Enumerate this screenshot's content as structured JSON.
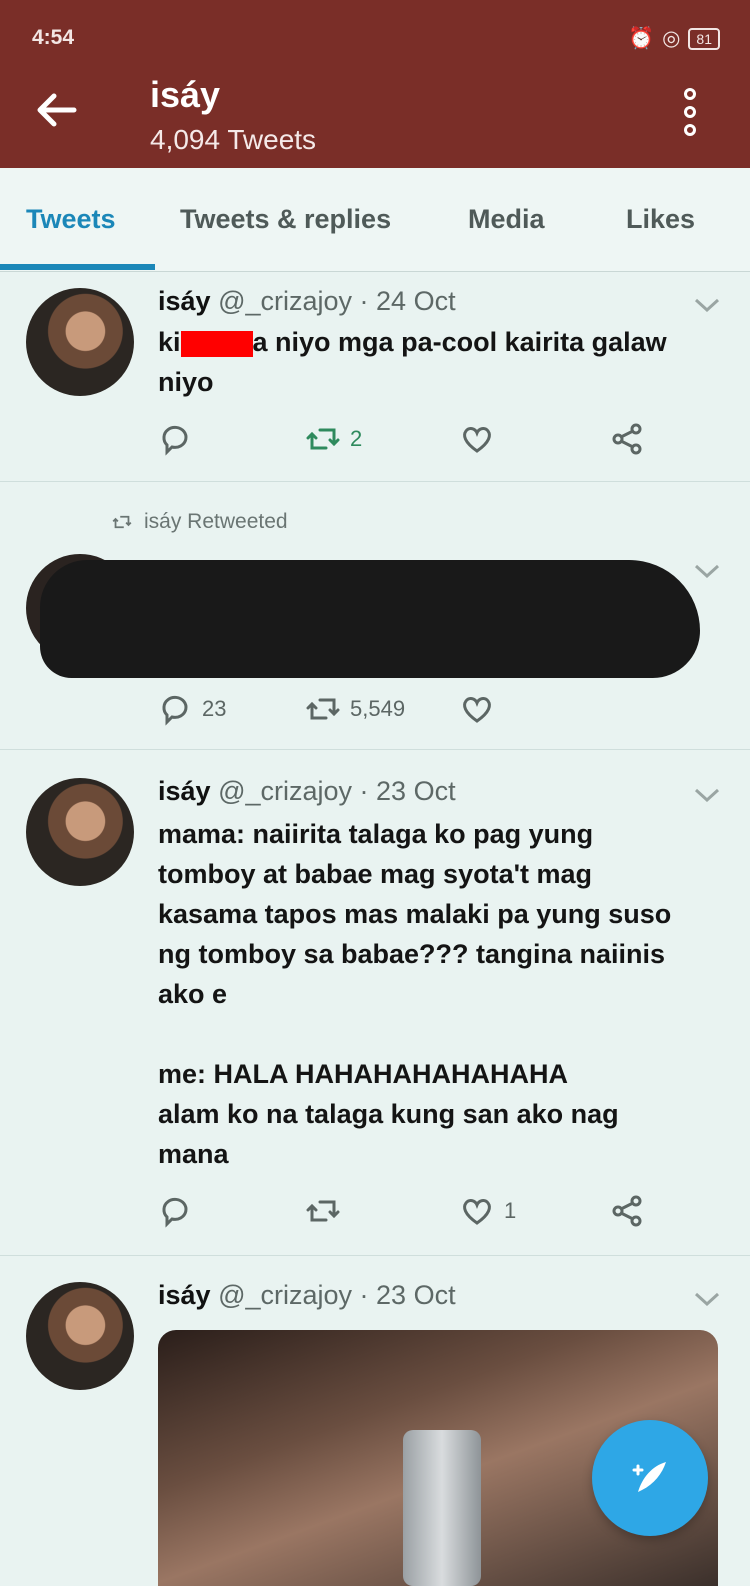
{
  "status": {
    "time": "4:54",
    "battery": "81"
  },
  "header": {
    "title": "isáy",
    "subtitle": "4,094 Tweets"
  },
  "tabs": [
    {
      "label": "Tweets",
      "active": true
    },
    {
      "label": "Tweets & replies",
      "active": false
    },
    {
      "label": "Media",
      "active": false
    },
    {
      "label": "Likes",
      "active": false
    }
  ],
  "tweets": [
    {
      "name": "isáy",
      "handle": "@_crizajoy",
      "date": "· 24 Oct",
      "text_lines": [
        "ki",
        "a niyo mga pa-cool kairita galaw",
        "niyo"
      ],
      "retweets": "2",
      "likes": ""
    },
    {
      "retweeted_note": "isáy Retweeted",
      "replies": "23",
      "retweets": "5,549"
    },
    {
      "name": "isáy",
      "handle": "@_crizajoy",
      "date": "· 23 Oct",
      "text_lines": [
        "mama: naiirita talaga ko pag yung",
        "tomboy at babae mag syota't mag",
        "kasama tapos mas malaki pa yung suso",
        "ng tomboy sa babae??? tangina naiinis",
        "ako e",
        "",
        "me: HALA HAHAHAHAHAHAHA",
        "alam ko na talaga kung san ako nag",
        "mana"
      ],
      "retweets": "",
      "likes": "1"
    },
    {
      "name": "isáy",
      "handle": "@_crizajoy",
      "date": "· 23 Oct"
    }
  ],
  "colors": {
    "header": "#7a2e28",
    "accent": "#1b87b8",
    "fab": "#2ea7e6",
    "retweet": "#2e8a5d"
  },
  "icons": [
    "back-arrow-icon",
    "more-vertical-icon",
    "reply-icon",
    "retweet-icon",
    "like-icon",
    "share-icon",
    "compose-icon"
  ]
}
